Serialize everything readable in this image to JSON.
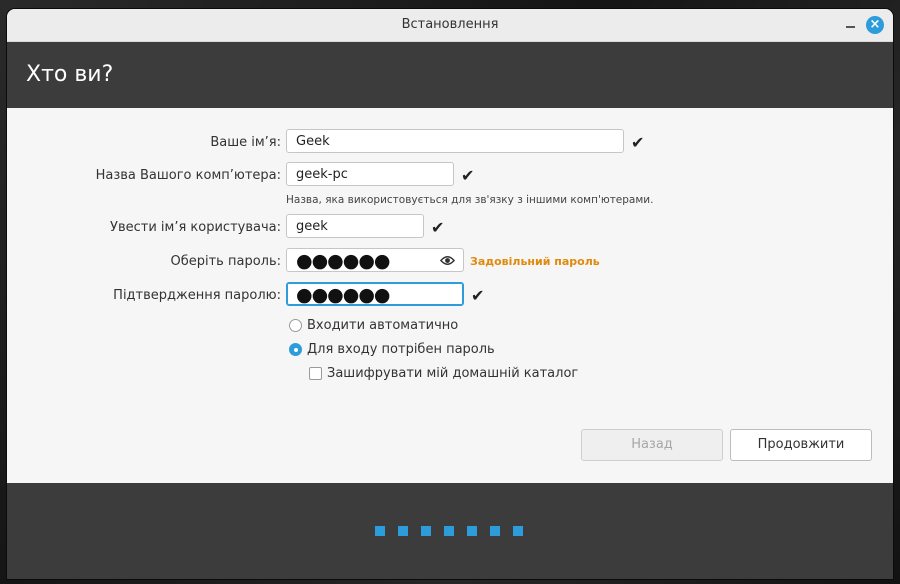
{
  "window": {
    "title": "Встановлення"
  },
  "header": {
    "title": "Хто ви?"
  },
  "form": {
    "name_label": "Ваше ім’я:",
    "name_value": "Geek",
    "computer_label": "Назва Вашого комп’ютера:",
    "computer_value": "geek-pc",
    "computer_hint": "Назва, яка використовується для зв'язку з іншими комп'ютерами.",
    "username_label": "Увести ім’я користувача:",
    "username_value": "geek",
    "password_label": "Оберіть пароль:",
    "password_mask": "●●●●●●",
    "password_strength": "Задовільний пароль",
    "confirm_label": "Підтвердження паролю:",
    "confirm_mask": "●●●●●●",
    "check_mark": "✔",
    "login_auto_label": "Входити автоматично",
    "login_password_label": "Для входу потрібен пароль",
    "encrypt_label": "Зашифрувати мій домашній каталог"
  },
  "buttons": {
    "back": "Назад",
    "continue": "Продовжити"
  },
  "progress": {
    "steps": 7,
    "current": 7
  },
  "colors": {
    "accent": "#2d9cdb",
    "warning": "#e08a0c",
    "header_bg": "#3c3c3c"
  },
  "icons": {
    "close": "close-icon",
    "minimize": "minimize-icon",
    "eye": "eye-icon",
    "check": "check-icon"
  }
}
